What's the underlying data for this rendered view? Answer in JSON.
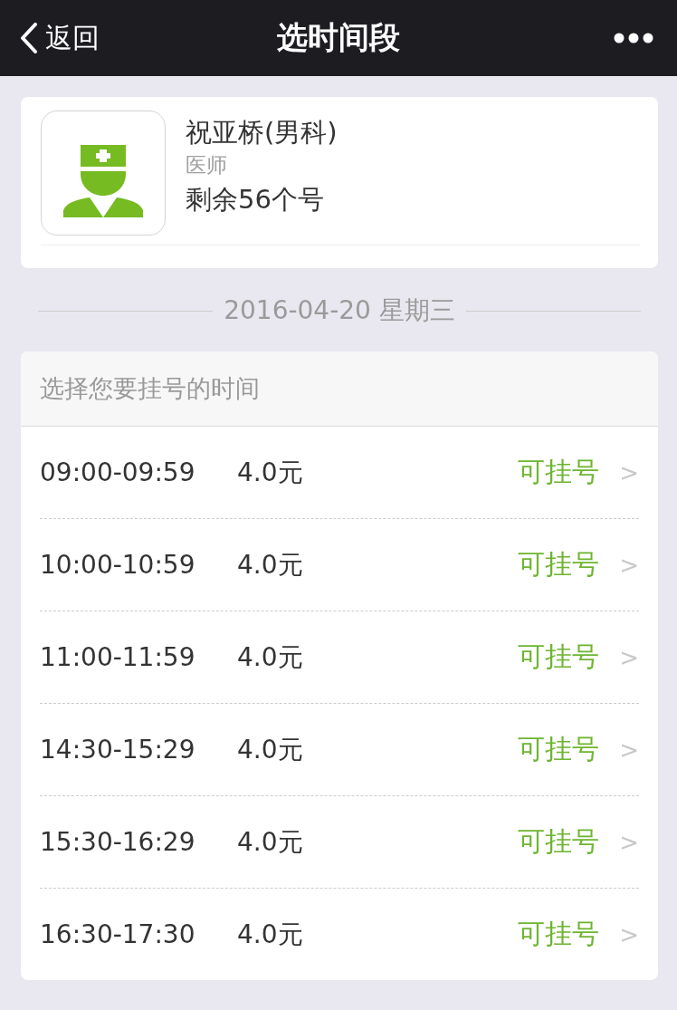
{
  "nav": {
    "back": "返回",
    "title": "选时间段"
  },
  "doctor": {
    "name": "祝亚桥(男科)",
    "role": "医师",
    "remaining": "剩余56个号"
  },
  "date": "2016-04-20 星期三",
  "slots": {
    "header": "选择您要挂号的时间",
    "rows": [
      {
        "time": "09:00-09:59",
        "price": "4.0元",
        "status": "可挂号",
        "arrow": ">"
      },
      {
        "time": "10:00-10:59",
        "price": "4.0元",
        "status": "可挂号",
        "arrow": ">"
      },
      {
        "time": "11:00-11:59",
        "price": "4.0元",
        "status": "可挂号",
        "arrow": ">"
      },
      {
        "time": "14:30-15:29",
        "price": "4.0元",
        "status": "可挂号",
        "arrow": ">"
      },
      {
        "time": "15:30-16:29",
        "price": "4.0元",
        "status": "可挂号",
        "arrow": ">"
      },
      {
        "time": "16:30-17:30",
        "price": "4.0元",
        "status": "可挂号",
        "arrow": ">"
      }
    ]
  }
}
